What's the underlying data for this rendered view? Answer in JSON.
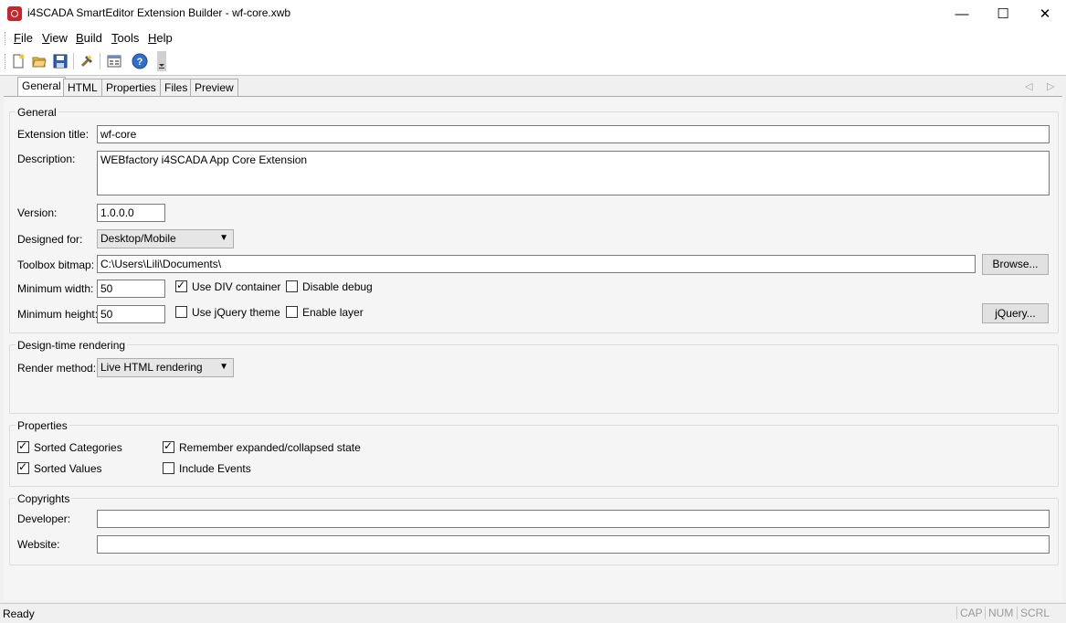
{
  "window": {
    "title": "i4SCADA SmartEditor Extension Builder - wf-core.xwb",
    "minimize": "—",
    "maximize": "☐",
    "close": "✕"
  },
  "menu": {
    "items": [
      {
        "label": "File",
        "accel": "F",
        "rest": "ile"
      },
      {
        "label": "View",
        "accel": "V",
        "rest": "iew"
      },
      {
        "label": "Build",
        "accel": "B",
        "rest": "uild"
      },
      {
        "label": "Tools",
        "accel": "T",
        "rest": "ools"
      },
      {
        "label": "Help",
        "accel": "H",
        "rest": "elp"
      }
    ]
  },
  "toolbar": {
    "icons": [
      "new-file-icon",
      "open-folder-icon",
      "save-icon",
      "build-icon",
      "options-icon",
      "help-icon",
      "overflow-icon"
    ]
  },
  "tabs": [
    "General",
    "HTML",
    "Properties",
    "Files",
    "Preview"
  ],
  "general": {
    "group_title": "General",
    "extension_title_label": "Extension title:",
    "extension_title_value": "wf-core",
    "description_label": "Description:",
    "description_value": "WEBfactory i4SCADA App Core Extension",
    "version_label": "Version:",
    "version_value": "1.0.0.0",
    "designed_for_label": "Designed for:",
    "designed_for_value": "Desktop/Mobile",
    "toolbox_bitmap_label": "Toolbox bitmap:",
    "toolbox_bitmap_value": "C:\\Users\\Lili\\Documents\\",
    "browse_label": "Browse...",
    "min_width_label": "Minimum width:",
    "min_width_value": "50",
    "min_height_label": "Minimum height:",
    "min_height_value": "50",
    "use_div_label": "Use DIV container",
    "disable_debug_label": "Disable debug",
    "use_jquery_label": "Use jQuery theme",
    "enable_layer_label": "Enable layer",
    "jquery_label": "jQuery..."
  },
  "design_time": {
    "group_title": "Design-time rendering",
    "render_method_label": "Render method:",
    "render_method_value": "Live HTML rendering"
  },
  "properties": {
    "group_title": "Properties",
    "sorted_categories": "Sorted Categories",
    "sorted_values": "Sorted Values",
    "remember_state": "Remember expanded/collapsed state",
    "include_events": "Include Events"
  },
  "copyrights": {
    "group_title": "Copyrights",
    "developer_label": "Developer:",
    "website_label": "Website:"
  },
  "status": {
    "text": "Ready",
    "cap": "CAP",
    "num": "NUM",
    "scrl": "SCRL"
  }
}
